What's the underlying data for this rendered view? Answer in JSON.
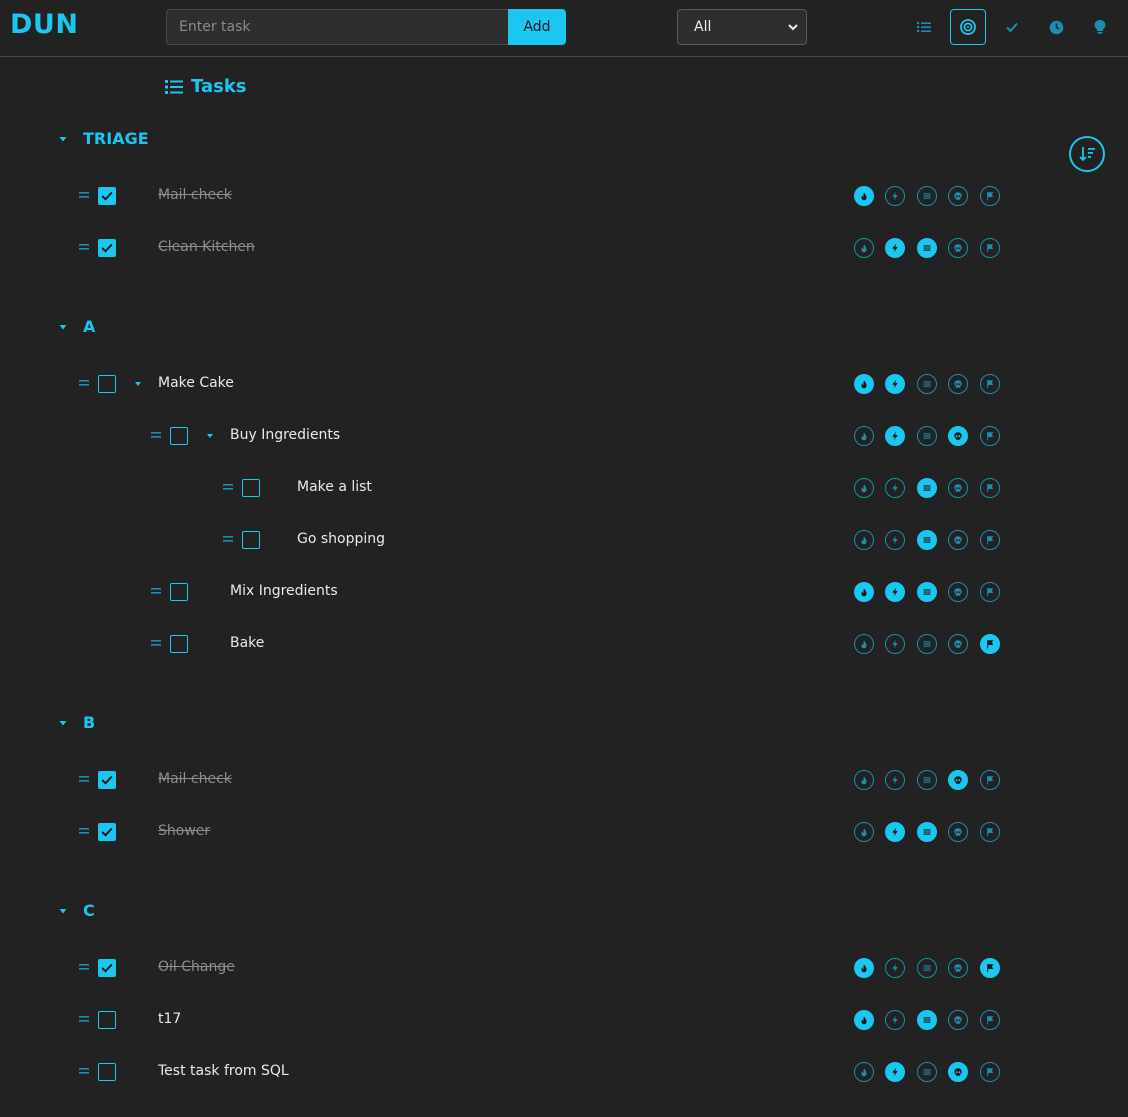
{
  "app": {
    "logo": "DUN"
  },
  "header": {
    "input_placeholder": "Enter task",
    "add_label": "Add",
    "filter_value": "All",
    "nav": [
      {
        "icon": "list-icon",
        "active": false
      },
      {
        "icon": "target-icon",
        "active": true
      },
      {
        "icon": "check-icon",
        "active": false
      },
      {
        "icon": "clock-icon",
        "active": false
      },
      {
        "icon": "lightbulb-icon",
        "active": false
      }
    ]
  },
  "page": {
    "title": "Tasks"
  },
  "tag_icons": [
    "fire-icon",
    "bolt-icon",
    "lines-icon",
    "skull-icon",
    "flag-icon"
  ],
  "colors": {
    "accent": "#1bc6f0",
    "background": "#222222",
    "done_text": "#8d8d8d"
  },
  "groups": [
    {
      "name": "TRIAGE",
      "tasks": [
        {
          "text": "Mail check",
          "done": true,
          "depth": 0,
          "has_children": false,
          "tags": [
            true,
            false,
            false,
            false,
            false
          ]
        },
        {
          "text": "Clean Kitchen",
          "done": true,
          "depth": 0,
          "has_children": false,
          "tags": [
            false,
            true,
            true,
            false,
            false
          ]
        }
      ]
    },
    {
      "name": "A",
      "tasks": [
        {
          "text": "Make Cake",
          "done": false,
          "depth": 0,
          "has_children": true,
          "tags": [
            true,
            true,
            false,
            false,
            false
          ]
        },
        {
          "text": "Buy Ingredients",
          "done": false,
          "depth": 1,
          "has_children": true,
          "tags": [
            false,
            true,
            false,
            true,
            false
          ]
        },
        {
          "text": "Make a list",
          "done": false,
          "depth": 2,
          "has_children": false,
          "tags": [
            false,
            false,
            true,
            false,
            false
          ]
        },
        {
          "text": "Go shopping",
          "done": false,
          "depth": 2,
          "has_children": false,
          "tags": [
            false,
            false,
            true,
            false,
            false
          ]
        },
        {
          "text": "Mix Ingredients",
          "done": false,
          "depth": 1,
          "has_children": false,
          "tags": [
            true,
            true,
            true,
            false,
            false
          ]
        },
        {
          "text": "Bake",
          "done": false,
          "depth": 1,
          "has_children": false,
          "tags": [
            false,
            false,
            false,
            false,
            true
          ]
        }
      ]
    },
    {
      "name": "B",
      "tasks": [
        {
          "text": "Mail check",
          "done": true,
          "depth": 0,
          "has_children": false,
          "tags": [
            false,
            false,
            false,
            true,
            false
          ]
        },
        {
          "text": "Shower",
          "done": true,
          "depth": 0,
          "has_children": false,
          "tags": [
            false,
            true,
            true,
            false,
            false
          ]
        }
      ]
    },
    {
      "name": "C",
      "tasks": [
        {
          "text": "Oil Change",
          "done": true,
          "depth": 0,
          "has_children": false,
          "tags": [
            true,
            false,
            false,
            false,
            true
          ]
        },
        {
          "text": "t17",
          "done": false,
          "depth": 0,
          "has_children": false,
          "tags": [
            true,
            false,
            true,
            false,
            false
          ]
        },
        {
          "text": "Test task from SQL",
          "done": false,
          "depth": 0,
          "has_children": false,
          "tags": [
            false,
            true,
            false,
            true,
            false
          ]
        }
      ]
    }
  ]
}
